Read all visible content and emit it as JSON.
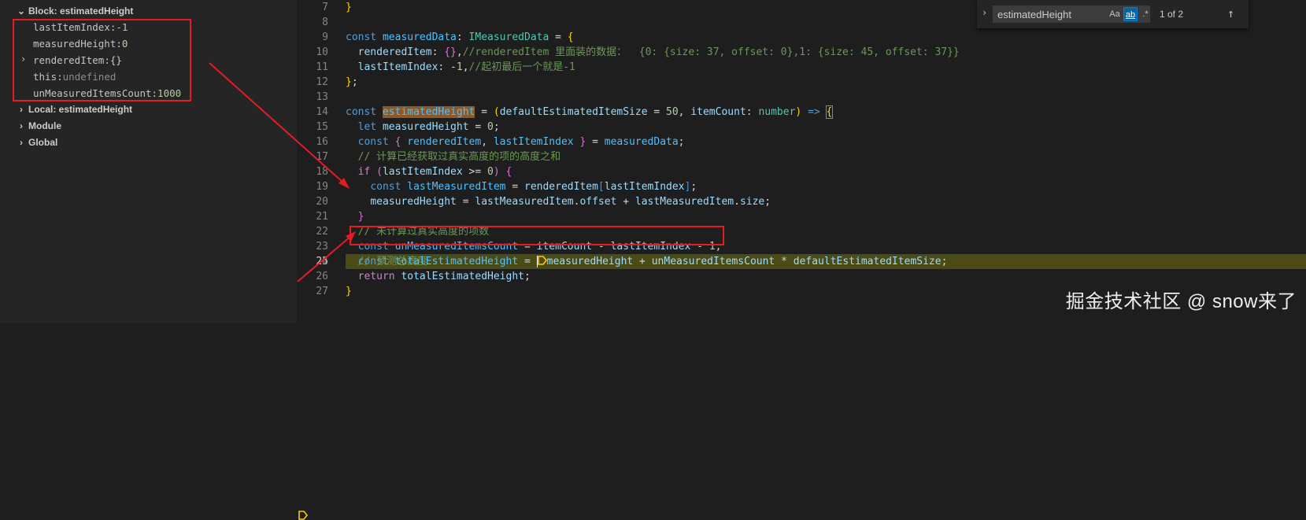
{
  "variables": {
    "block_scope": {
      "label": "Block: estimatedHeight",
      "items": [
        {
          "name": "lastItemIndex",
          "value": "-1"
        },
        {
          "name": "measuredHeight",
          "value": "0"
        },
        {
          "name": "renderedItem",
          "value": "{}"
        },
        {
          "name": "this",
          "value": "undefined"
        },
        {
          "name": "unMeasuredItemsCount",
          "value": "1000"
        }
      ]
    },
    "other_scopes": [
      "Local: estimatedHeight",
      "Module",
      "Global"
    ]
  },
  "find_widget": {
    "query": "estimatedHeight",
    "match_case": "Aa",
    "whole_word": "ab",
    "regex": ".*",
    "result": "1 of 2",
    "prev_icon": "arrow-up-icon"
  },
  "editor": {
    "line_numbers": [
      "7",
      "8",
      "9",
      "10",
      "11",
      "12",
      "13",
      "14",
      "15",
      "16",
      "17",
      "18",
      "19",
      "20",
      "21",
      "22",
      "23",
      "24",
      "25",
      "26",
      "27"
    ],
    "active_line": "25",
    "comments": {
      "line10": "//renderedItem 里面装的数据：  {0: {size: 37, offset: 0},1: {size: 45, offset: 37}}",
      "line11": "//起初最后一个就是-1",
      "line17": "// 计算已经获取过真实高度的项的高度之和",
      "line22": "// 未计算过真实高度的项数",
      "line24": "// 预测总高度"
    }
  },
  "watermark": "掘金技术社区 @ snow来了",
  "colors": {
    "highlight_box": "#e51c23",
    "active_line_bg": "#4b4b18",
    "breakpoint": "#ffcc00"
  }
}
